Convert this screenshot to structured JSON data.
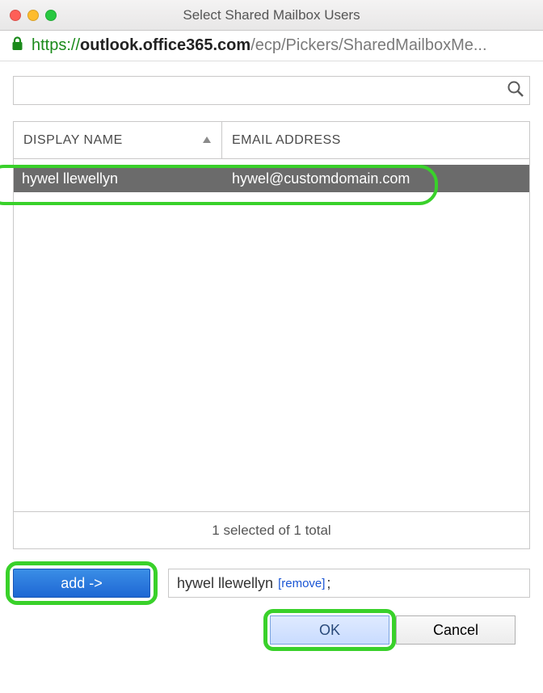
{
  "window": {
    "title": "Select Shared Mailbox Users"
  },
  "url": {
    "protocol": "https://",
    "domain": "outlook.office365.com",
    "rest": "/ecp/Pickers/SharedMailboxMe..."
  },
  "search": {
    "value": ""
  },
  "table": {
    "columns": {
      "name": "DISPLAY NAME",
      "email": "EMAIL ADDRESS"
    },
    "rows": [
      {
        "name": "hywel llewellyn",
        "email": "hywel@customdomain.com",
        "selected": true
      }
    ],
    "status": "1 selected of 1 total"
  },
  "actions": {
    "add_label": "add ->",
    "selected_name": "hywel llewellyn",
    "remove_label": "[remove]",
    "terminator": ";"
  },
  "buttons": {
    "ok": "OK",
    "cancel": "Cancel"
  }
}
